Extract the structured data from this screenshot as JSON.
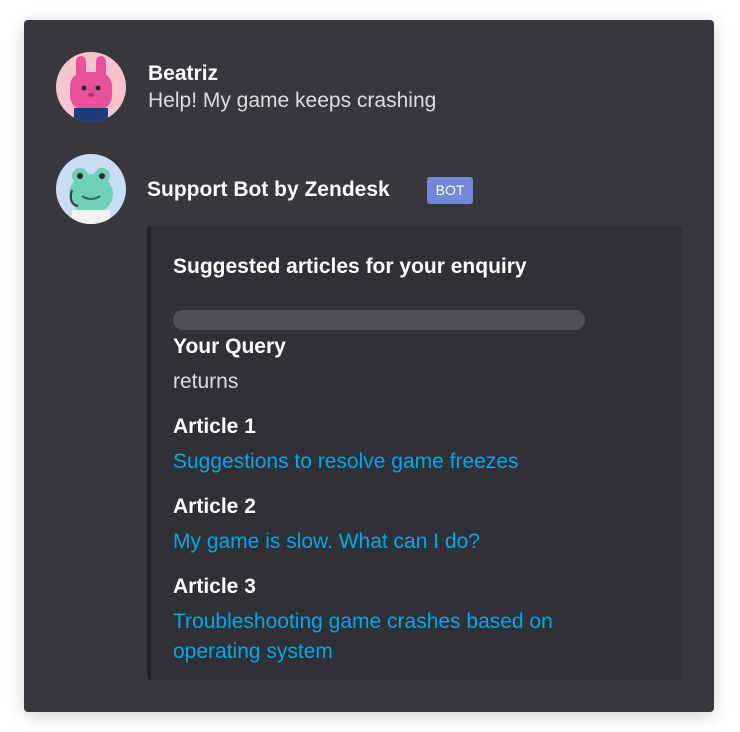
{
  "user_message": {
    "username": "Beatriz",
    "text": "Help! My game keeps crashing",
    "avatar_icon": "pink-bunny-avatar-icon"
  },
  "bot_message": {
    "username": "Support Bot by Zendesk",
    "tag": "BOT",
    "avatar_icon": "frog-agent-avatar-icon",
    "embed": {
      "title": "Suggested articles for your enquiry",
      "fields": [
        {
          "name": "Your Query",
          "value": "returns"
        },
        {
          "name": "Article 1",
          "value": "Suggestions to resolve game freezes"
        },
        {
          "name": "Article 2",
          "value": "My game is slow. What can I do?"
        },
        {
          "name": "Article 3",
          "value": "Troubleshooting game crashes based on operating system"
        }
      ]
    }
  },
  "colors": {
    "background": "#36383e",
    "embed_background": "#2f3136",
    "link": "#00a8e8",
    "bot_tag": "#7289da"
  }
}
